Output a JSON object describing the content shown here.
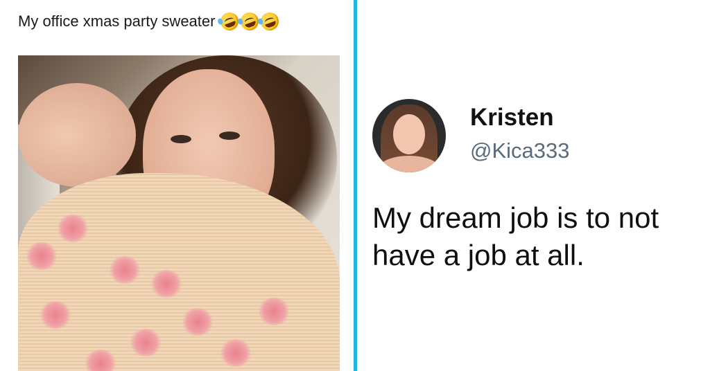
{
  "left_post": {
    "caption": "My office xmas party sweater",
    "emoji_icons": [
      "rolling-on-floor-laughing-icon",
      "rolling-on-floor-laughing-icon",
      "rolling-on-floor-laughing-icon"
    ]
  },
  "divider_color": "#1fb6e0",
  "right_tweet": {
    "name": "Kristen",
    "handle": "@Kica333",
    "text": "My dream job is to not have a job at all."
  }
}
